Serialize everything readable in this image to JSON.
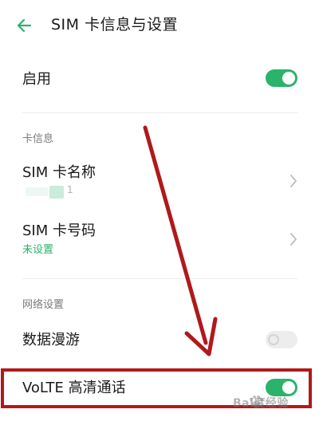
{
  "header": {
    "back_icon": "arrow-left-icon",
    "title": "SIM 卡信息与设置"
  },
  "colors": {
    "accent": "#2bb36c",
    "annotation": "#b0191b",
    "section_label": "#7a7a7a"
  },
  "enable_row": {
    "label": "启用",
    "toggle_on": true
  },
  "card_info_section": {
    "label": "卡信息",
    "items": [
      {
        "title": "SIM 卡名称",
        "value": "1",
        "chevron_icon": "chevron-right-icon"
      },
      {
        "title": "SIM 卡号码",
        "value": "未设置",
        "chevron_icon": "chevron-right-icon"
      }
    ]
  },
  "network_section": {
    "label": "网络设置",
    "items": [
      {
        "title": "数据漫游",
        "toggle_on": false
      },
      {
        "title": "VoLTE 高清通话",
        "toggle_on": true
      }
    ]
  },
  "watermark": {
    "text": "Bai度经验",
    "icon": "baidu-paw-icon"
  }
}
